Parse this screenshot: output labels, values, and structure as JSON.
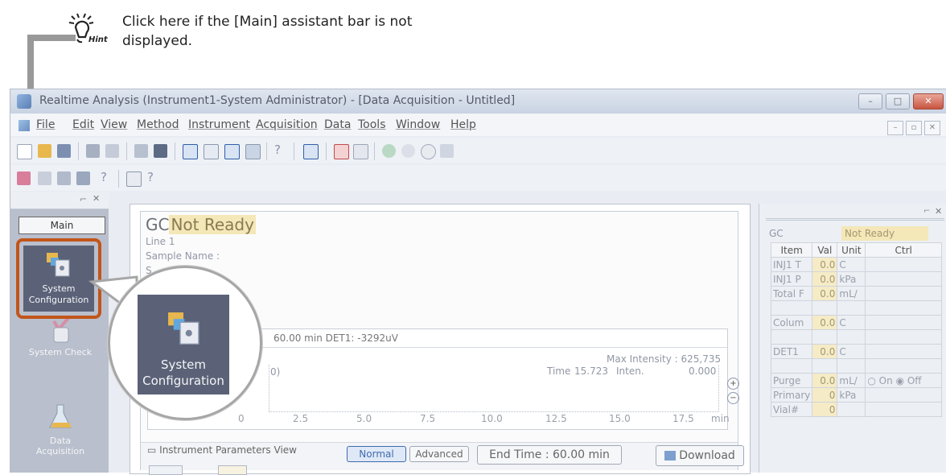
{
  "hint": {
    "badge": "Hint",
    "text_line1": "Click here if the [Main] assistant bar is not",
    "text_line2": "displayed."
  },
  "window": {
    "title": "Realtime Analysis (Instrument1-System Administrator) - [Data Acquisition - Untitled]",
    "menu": [
      "File",
      "Edit",
      "View",
      "Method",
      "Instrument",
      "Acquisition",
      "Data",
      "Tools",
      "Window",
      "Help"
    ]
  },
  "left_panel": {
    "main_tab": "Main",
    "items": [
      {
        "label_line1": "System",
        "label_line2": "Configuration"
      },
      {
        "label_line1": "System Check",
        "label_line2": ""
      },
      {
        "label_line1": "Data",
        "label_line2": "Acquisition"
      }
    ]
  },
  "gc_pane": {
    "prefix": "GC",
    "status": "Not Ready",
    "line": "Line 1",
    "sample_name_label": "Sample Name :",
    "sample_id_fragment": "S",
    "chart_header": "60.00 min DET1: -3292uV",
    "max_intensity": "Max Intensity : 625,735",
    "time_label": "Time",
    "time_value": "15.723",
    "inten_label": "Inten.",
    "inten_value": "0.000",
    "y_fragment": "0)",
    "x_fragment": "0",
    "x_ticks": [
      "2.5",
      "5.0",
      "7.5",
      "10.0",
      "12.5",
      "15.0",
      "17.5"
    ],
    "x_unit": "min",
    "params_title": "Instrument Parameters View",
    "normal": "Normal",
    "advanced": "Advanced",
    "end_time": "End Time : 60.00 min",
    "download": "Download"
  },
  "right_pane": {
    "gc_label": "GC",
    "status": "Not Ready",
    "headers": [
      "Item",
      "Val",
      "Unit",
      "Ctrl"
    ],
    "rows": [
      {
        "item": "INJ1 T",
        "val": "0.0",
        "unit": "C"
      },
      {
        "item": "INJ1 P",
        "val": "0.0",
        "unit": "kPa"
      },
      {
        "item": "Total F",
        "val": "0.0",
        "unit": "mL/"
      },
      {
        "item": "",
        "val": "",
        "unit": ""
      },
      {
        "item": "Colum",
        "val": "0.0",
        "unit": "C"
      },
      {
        "item": "",
        "val": "",
        "unit": ""
      },
      {
        "item": "DET1",
        "val": "0.0",
        "unit": "C"
      },
      {
        "item": "",
        "val": "",
        "unit": ""
      },
      {
        "item": "Purge",
        "val": "0.0",
        "unit": "mL/",
        "ctrl_on": "On",
        "ctrl_off": "Off"
      },
      {
        "item": "Primary",
        "val": "0",
        "unit": "kPa"
      },
      {
        "item": "Vial#",
        "val": "0",
        "unit": ""
      }
    ]
  },
  "zoom": {
    "label_line1": "System",
    "label_line2": "Configuration"
  },
  "colors": {
    "highlight": "#c2551b",
    "tile_bg": "#5b6278",
    "status_bg": "#f4e7b8"
  }
}
